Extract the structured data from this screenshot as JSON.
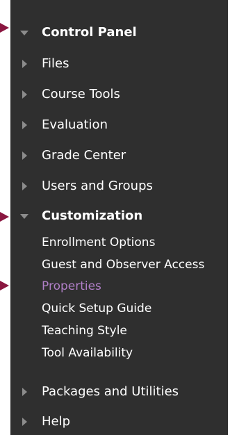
{
  "menu": {
    "control_panel": "Control Panel",
    "files": "Files",
    "course_tools": "Course Tools",
    "evaluation": "Evaluation",
    "grade_center": "Grade Center",
    "users_and_groups": "Users and Groups",
    "customization": "Customization",
    "customization_items": [
      "Enrollment Options",
      "Guest and Observer Access",
      "Properties",
      "Quick Setup Guide",
      "Teaching Style",
      "Tool Availability"
    ],
    "packages_and_utilities": "Packages and Utilities",
    "help": "Help"
  },
  "colors": {
    "panel_bg": "#2f2f2f",
    "text": "#ffffff",
    "active_link": "#b07fc7",
    "pointer_arrow": "#8a1640",
    "chevron": "#8c8c8c"
  }
}
